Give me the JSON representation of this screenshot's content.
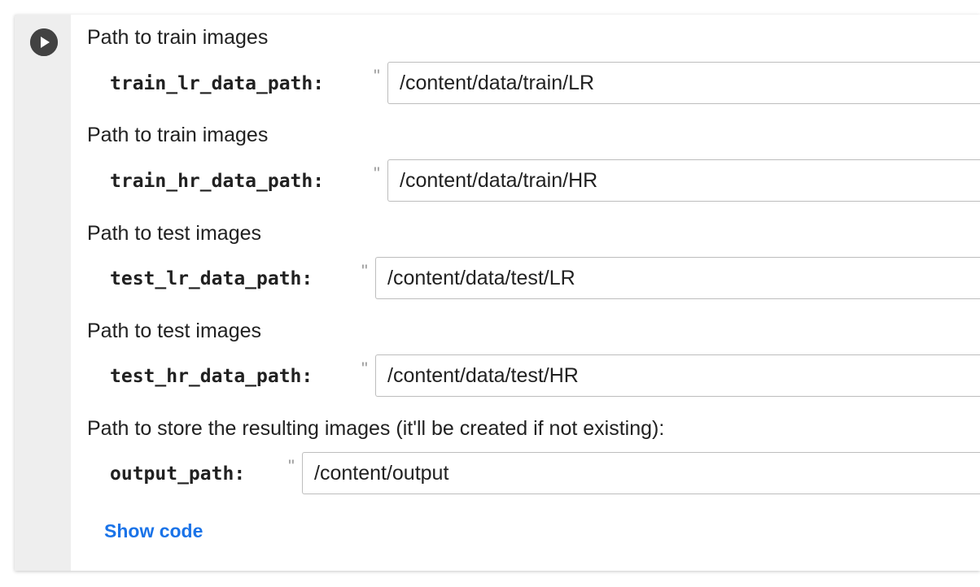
{
  "cell": {
    "run_icon": "play-circle-icon",
    "fields": [
      {
        "description": "Path to train images",
        "name": "train_lr_data_path:",
        "quote": "\"",
        "value": "/content/data/train/LR"
      },
      {
        "description": "Path to train images",
        "name": "train_hr_data_path:",
        "quote": "\"",
        "value": "/content/data/train/HR"
      },
      {
        "description": "Path to test images",
        "name": "test_lr_data_path:",
        "quote": "\"",
        "value": "/content/data/test/LR"
      },
      {
        "description": "Path to test images",
        "name": "test_hr_data_path:",
        "quote": "\"",
        "value": "/content/data/test/HR"
      },
      {
        "description": "Path to store the resulting images (it'll be created if not existing):",
        "name": "output_path:",
        "quote": "\"",
        "value": "/content/output"
      }
    ],
    "show_code_label": "Show code"
  },
  "colors": {
    "link": "#1a73e8",
    "gutter": "#eeeeee",
    "run_button": "#424242"
  }
}
